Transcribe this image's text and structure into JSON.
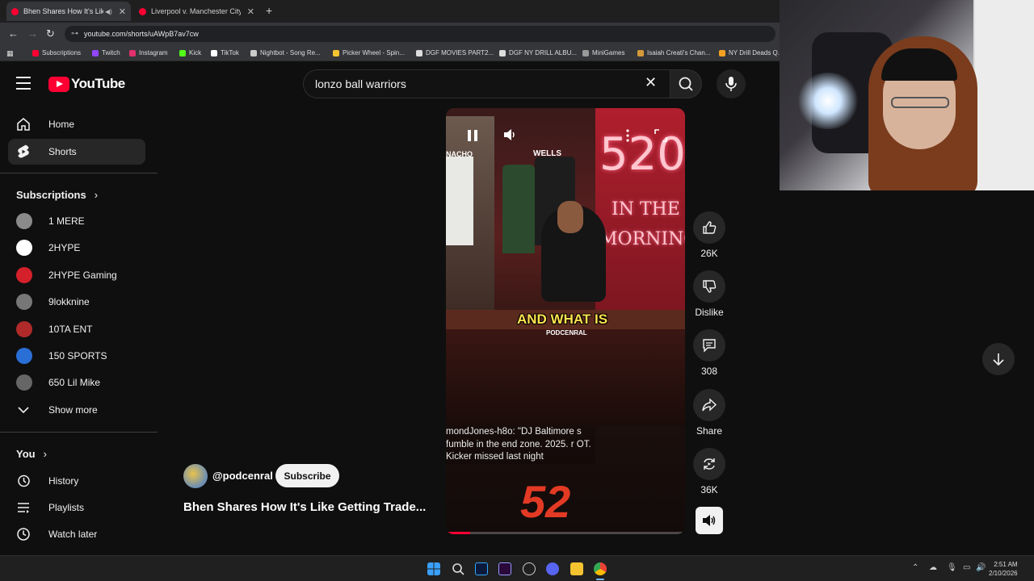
{
  "browser": {
    "tabs": [
      {
        "title": "Bhen Shares How It's Like G",
        "active": true
      },
      {
        "title": "Liverpool v. Manchester City | P",
        "active": false
      }
    ],
    "url": "youtube.com/shorts/uAWpB7av7cw",
    "bookmarks": [
      {
        "label": "Subscriptions",
        "color": "#ff0033"
      },
      {
        "label": "Twitch",
        "color": "#9146ff"
      },
      {
        "label": "Instagram",
        "color": "#e1306c"
      },
      {
        "label": "Kick",
        "color": "#53fc18"
      },
      {
        "label": "TikTok",
        "color": "#ffffff"
      },
      {
        "label": "Nightbot - Song Re...",
        "color": "#cccccc"
      },
      {
        "label": "Picker Wheel - Spin...",
        "color": "#f4c430"
      },
      {
        "label": "DGF MOVIES PART2...",
        "color": "#dddddd"
      },
      {
        "label": "DGF NY DRILL ALBU...",
        "color": "#dddddd"
      },
      {
        "label": "MiniGames",
        "color": "#999999"
      },
      {
        "label": "Isaiah Creati's Chan...",
        "color": "#d49a3a"
      },
      {
        "label": "NY Drill Deads Q...",
        "color": "#f4a020"
      }
    ]
  },
  "header": {
    "logo_text": "YouTube",
    "search_value": "lonzo ball warriors"
  },
  "sidebar": {
    "main": [
      {
        "label": "Home",
        "icon": "home-icon"
      },
      {
        "label": "Shorts",
        "icon": "shorts-icon",
        "active": true
      }
    ],
    "subscriptions_title": "Subscriptions",
    "subscriptions": [
      {
        "label": "1 MERE",
        "color": "#8a8a8a"
      },
      {
        "label": "2HYPE",
        "color": "#ffffff"
      },
      {
        "label": "2HYPE Gaming",
        "color": "#d4202a"
      },
      {
        "label": "9lokknine",
        "color": "#777777"
      },
      {
        "label": "10TA ENT",
        "color": "#b12a2a"
      },
      {
        "label": "150 SPORTS",
        "color": "#2a6fd6"
      },
      {
        "label": "650 Lil Mike",
        "color": "#666666"
      }
    ],
    "show_more": "Show more",
    "you_title": "You",
    "you_items": [
      {
        "label": "History",
        "icon": "history-icon"
      },
      {
        "label": "Playlists",
        "icon": "playlists-icon"
      },
      {
        "label": "Watch later",
        "icon": "watch-later-icon"
      }
    ]
  },
  "video": {
    "label_left": "NACHO",
    "label_mid": "WELLS",
    "neon_line1": "520",
    "neon_line2": "IN THE",
    "neon_line3": "MORNING",
    "caption": "AND WHAT IS",
    "caption_sub": "PODCENRAL",
    "ticker": "mondJones-h8o: \"DJ Baltimore s fumble in the end zone. 2025. r OT. Kicker missed last night",
    "bottom_logo": "52",
    "progress": 0.1
  },
  "actions": [
    {
      "name": "like",
      "icon": "thumbs-up-icon",
      "label": "26K"
    },
    {
      "name": "dislike",
      "icon": "thumbs-down-icon",
      "label": "Dislike"
    },
    {
      "name": "comments",
      "icon": "comment-icon",
      "label": "308"
    },
    {
      "name": "share",
      "icon": "share-icon",
      "label": "Share"
    },
    {
      "name": "remix",
      "icon": "remix-icon",
      "label": "36K"
    }
  ],
  "channel": {
    "handle": "@podcenral",
    "subscribe_label": "Subscribe",
    "short_title": "Bhen Shares How It's Like Getting Trade..."
  },
  "taskbar": {
    "time": "2:51 AM",
    "date": "2/10/2026"
  }
}
